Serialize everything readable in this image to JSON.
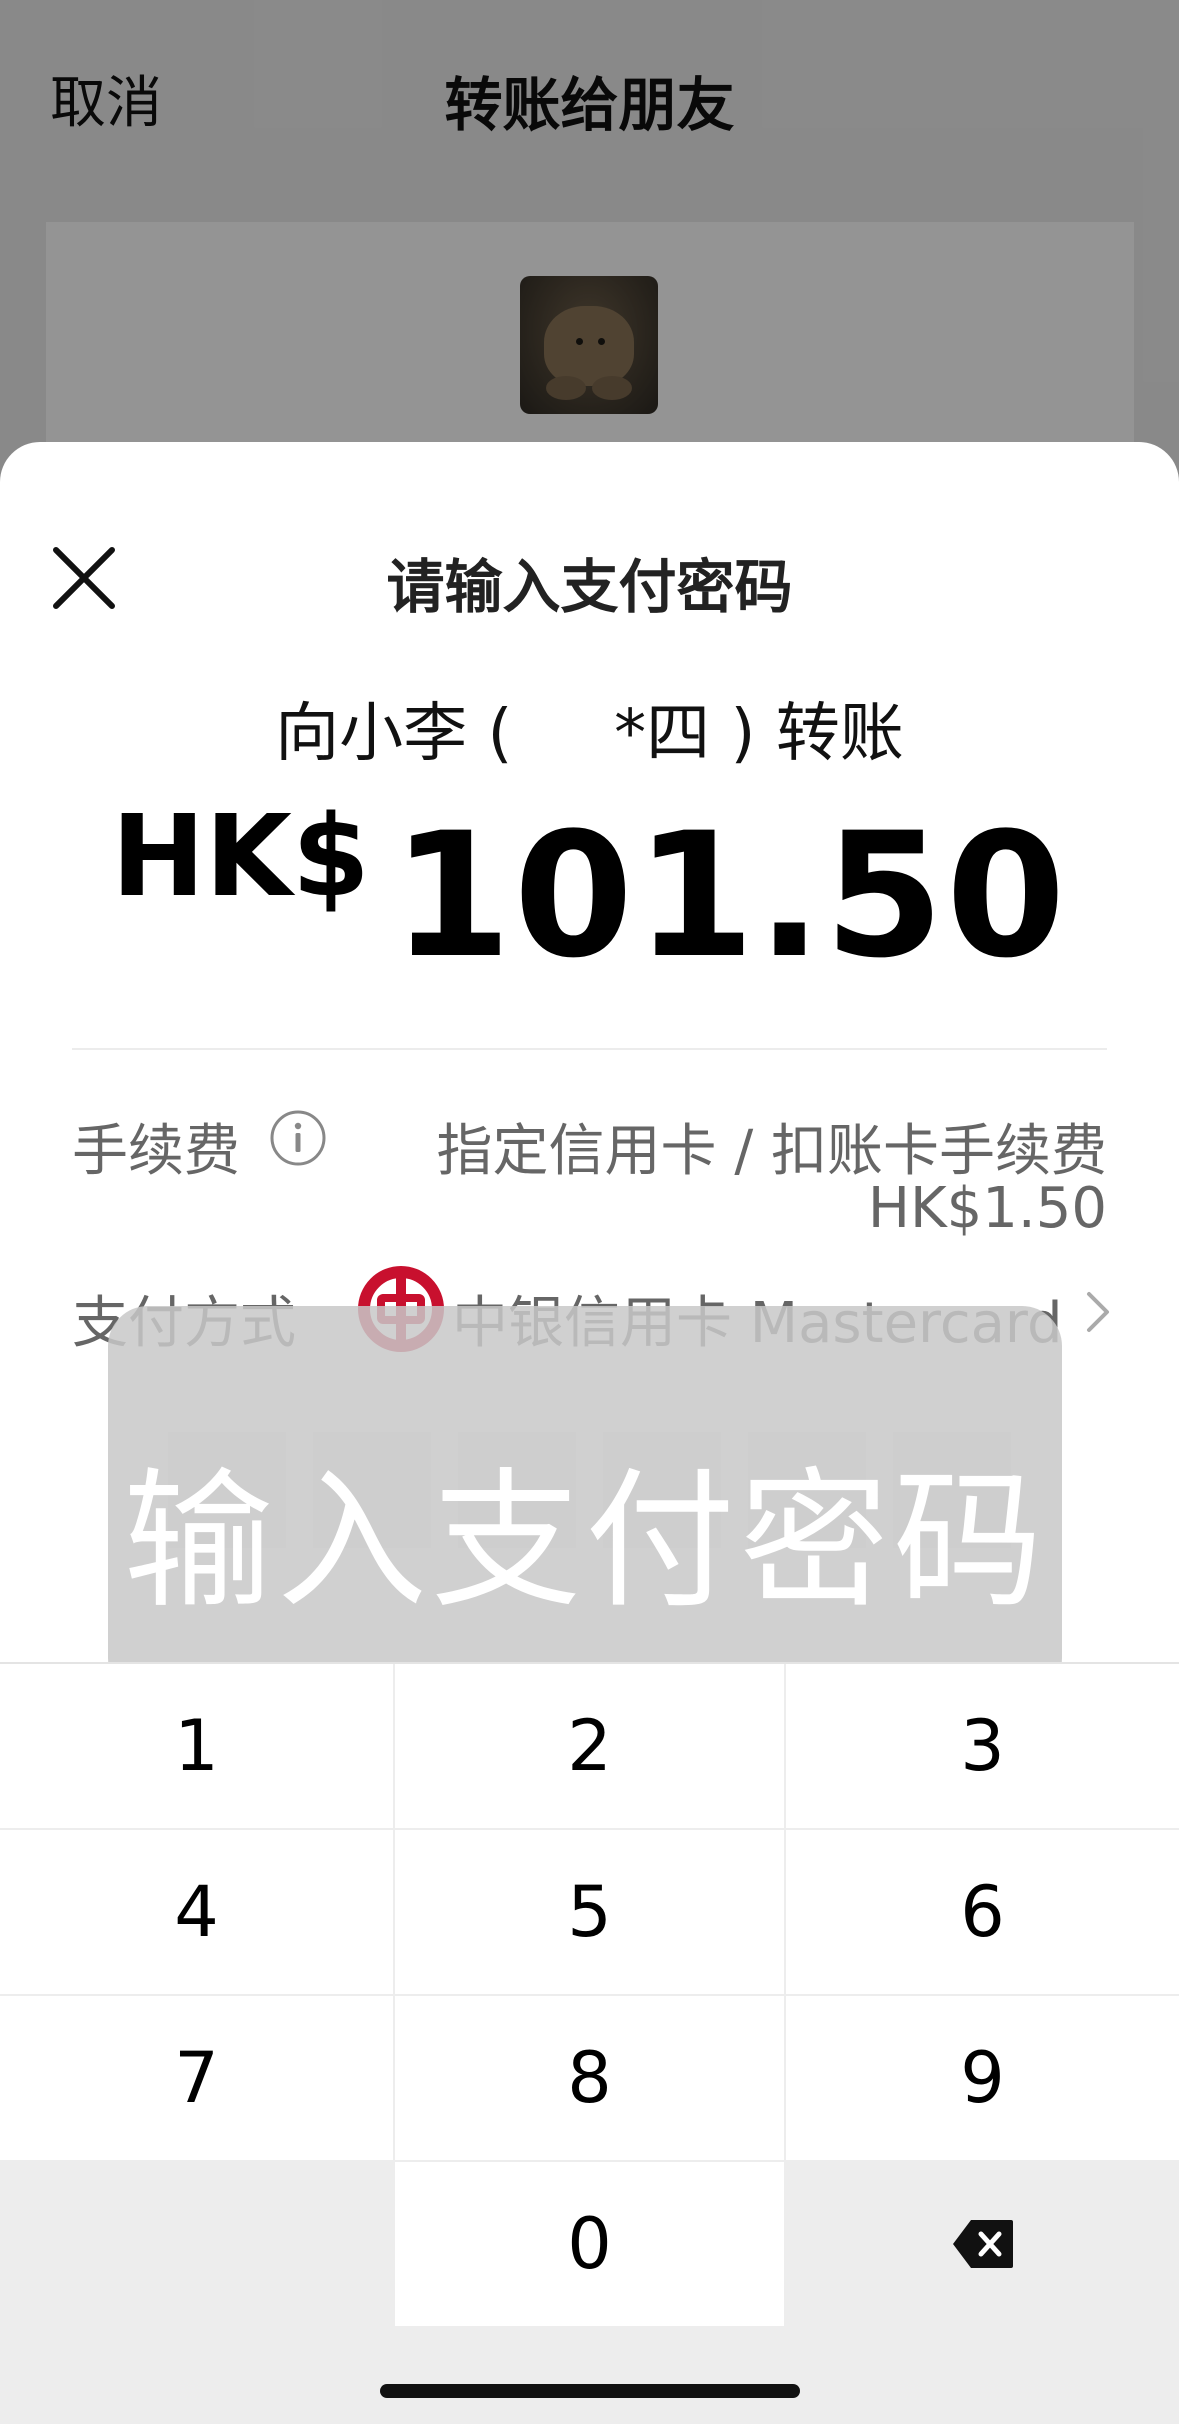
{
  "background_screen": {
    "cancel_label": "取消",
    "title": "转账给朋友"
  },
  "sheet": {
    "title": "请输入支付密码",
    "close_icon": "close-icon",
    "recipient": "向小李 (     *四 ) 转账",
    "currency": "HK$",
    "amount": "101.50",
    "fee": {
      "label": "手续费",
      "info_icon": "info-icon",
      "description": "指定信用卡 / 扣账卡手续费",
      "amount": "HK$1.50"
    },
    "payment": {
      "label": "支付方式",
      "bank_logo": "boc-logo-icon",
      "card": "中银信用卡 Mastercard",
      "chevron_icon": "chevron-right-icon"
    },
    "pin_length": 6
  },
  "toast": {
    "text": "输入支付密码"
  },
  "keypad": {
    "keys": [
      "1",
      "2",
      "3",
      "4",
      "5",
      "6",
      "7",
      "8",
      "9",
      "",
      "0",
      "delete"
    ],
    "delete_icon": "backspace-icon"
  },
  "colors": {
    "sheet_bg": "#ffffff",
    "keypad_bg": "#ededed",
    "boc_red": "#c8102e",
    "secondary_text": "#666666"
  }
}
